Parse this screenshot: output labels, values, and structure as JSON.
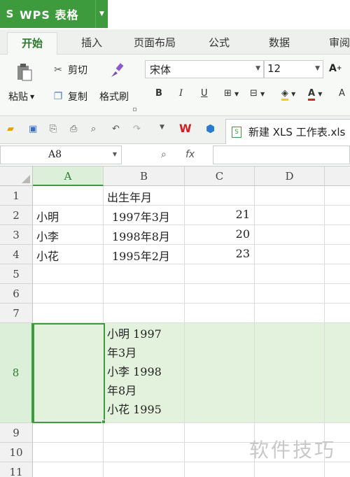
{
  "app": {
    "logo": "S",
    "title": "WPS 表格"
  },
  "tabs": [
    "开始",
    "插入",
    "页面布局",
    "公式",
    "数据",
    "审阅"
  ],
  "ribbon": {
    "paste": "粘贴",
    "cut": "剪切",
    "copy": "复制",
    "format_painter": "格式刷",
    "font_name": "宋体",
    "font_size": "12"
  },
  "document_tab": "新建 XLS 工作表.xls",
  "formula_bar": {
    "name_box": "A8",
    "fx": "fx",
    "value": ""
  },
  "grid": {
    "columns": [
      "A",
      "B",
      "C",
      "D"
    ],
    "rows": [
      "1",
      "2",
      "3",
      "4",
      "5",
      "6",
      "7",
      "8",
      "9",
      "10",
      "11"
    ],
    "cells": {
      "B1": "出生年月",
      "A2": "小明",
      "B2": "1997年3月",
      "C2": "21",
      "A3": "小李",
      "B3": "1998年8月",
      "C3": "20",
      "A4": "小花",
      "B4": "1995年2月",
      "C4": "23"
    },
    "b8_lines": [
      "小明 1997",
      "年3月",
      "小李 1998",
      "年8月",
      "小花 1995"
    ],
    "selected_cell": "A8",
    "selected_row": "8"
  },
  "watermark": "软件技巧",
  "colors": {
    "brand_green": "#3d9a3d",
    "selection_fill": "#e3f2dd"
  }
}
